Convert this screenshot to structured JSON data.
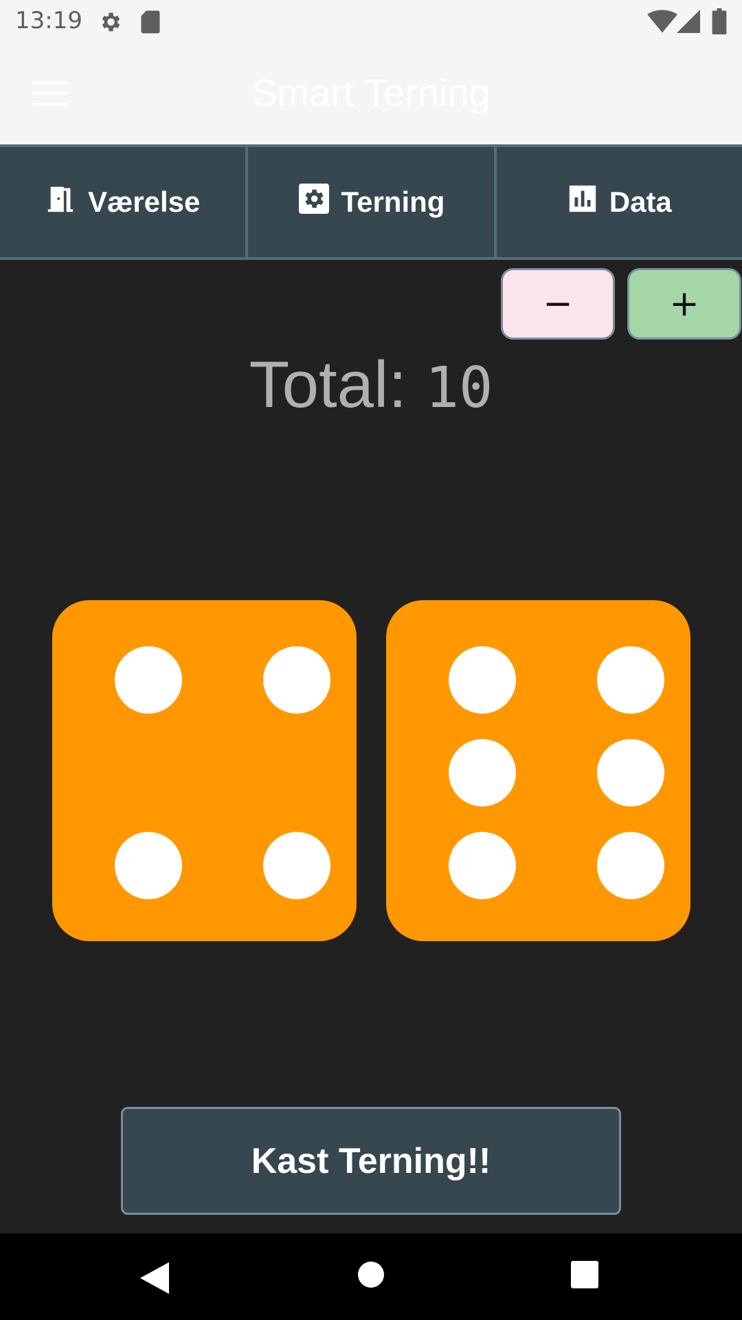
{
  "status_bar": {
    "time": "13:19",
    "icons": [
      "settings-icon",
      "sd-card-icon",
      "wifi-icon",
      "signal-icon",
      "battery-icon"
    ]
  },
  "app_bar": {
    "title": "Smart Terning",
    "menu_icon": "hamburger-menu-icon"
  },
  "tabs": [
    {
      "label": "Værelse",
      "icon": "door-icon"
    },
    {
      "label": "Terning",
      "icon": "gear-icon"
    },
    {
      "label": "Data",
      "icon": "bar-chart-icon"
    }
  ],
  "controls": {
    "minus_label": "−",
    "plus_label": "+"
  },
  "total": {
    "label": "Total:",
    "value": "10"
  },
  "dice": [
    {
      "value": 4,
      "color": "#ff9800"
    },
    {
      "value": 6,
      "color": "#ff9800"
    }
  ],
  "roll_button": {
    "label": "Kast Terning!!"
  },
  "nav_bar": {
    "buttons": [
      "back-icon",
      "home-icon",
      "recents-icon"
    ]
  },
  "colors": {
    "tab_bg": "#37474f",
    "dice": "#ff9800",
    "minus_bg": "#fce4ec",
    "plus_bg": "#a5d6a7",
    "background": "#212121"
  }
}
